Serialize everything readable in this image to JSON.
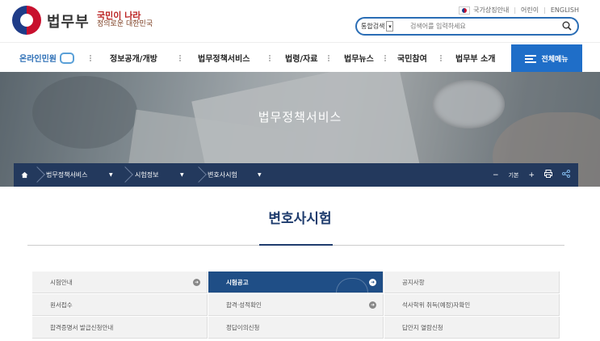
{
  "header": {
    "brand": "법무부",
    "slogan_line1": "국민이 나라",
    "slogan_line2": "정의로운 대한민국",
    "util": [
      "국가상징안내",
      "어린이",
      "ENGLISH"
    ],
    "search": {
      "scope": "통합검색",
      "placeholder": "검색어를 입력하세요"
    }
  },
  "nav": {
    "online": "온라인민원",
    "items": [
      "정보공개/개방",
      "법무정책서비스",
      "법령/자료",
      "법무뉴스",
      "국민참여",
      "법무부 소개"
    ],
    "all_menu": "전체메뉴"
  },
  "hero": {
    "title": "법무정책서비스"
  },
  "breadcrumb": {
    "items": [
      "법무정책서비스",
      "시험정보",
      "변호사시험"
    ],
    "zoom_minus": "−",
    "zoom_label": "기본",
    "zoom_plus": "+"
  },
  "page": {
    "title": "변호사시험"
  },
  "menu": [
    [
      "시험안내",
      "시험공고",
      "공지사항"
    ],
    [
      "원서접수",
      "합격·성적확인",
      "석사학위 취득(예정)자확인"
    ],
    [
      "합격증명서 발급신청안내",
      "정답이의신청",
      "답안지 열람신청"
    ]
  ],
  "colors": {
    "accent": "#1f6ec8",
    "active": "#1f4e86",
    "breadcrumb": "#23395d"
  }
}
